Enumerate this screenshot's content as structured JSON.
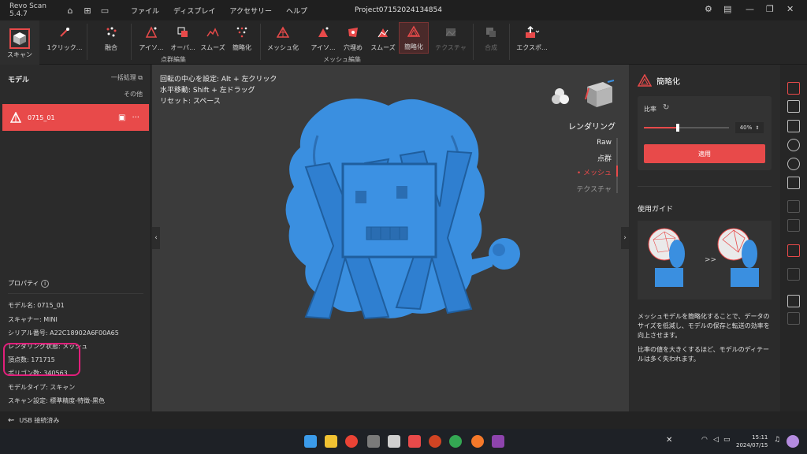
{
  "app": {
    "name": "Revo Scan 5.4.7",
    "project_title": "Project07152024134854"
  },
  "menu": [
    "ファイル",
    "ディスプレイ",
    "アクセサリー",
    "ヘルプ"
  ],
  "toolbar": {
    "scan": "スキャン",
    "one_click": "1クリック...",
    "fuse": "融合",
    "pc_iso": "アイソ...",
    "pc_over": "オーバ...",
    "pc_smooth": "スムーズ",
    "pc_simplify": "簡略化",
    "mesh": "メッシュ化",
    "m_iso": "アイソ...",
    "m_fill": "穴埋め",
    "m_smooth": "スムーズ",
    "m_simplify": "簡略化",
    "texture": "テクスチャ",
    "merge": "合成",
    "export": "エクスポ...",
    "group_pointcloud": "点群編集",
    "group_mesh": "メッシュ編集"
  },
  "left": {
    "header": "モデル",
    "batch": "一括処理",
    "other": "その他",
    "model_name": "0715_01",
    "props_header": "プロパティ",
    "props": [
      "モデル名: 0715_01",
      "スキャナー: MINI",
      "シリアル番号: A22C18902A6F00A65",
      "レンダリング状態: メッシュ",
      "頂点数: 171715",
      "ポリゴン数: 340563",
      "モデルタイプ: スキャン",
      "スキャン設定: 標準精度-特徴-黒色"
    ]
  },
  "viewport": {
    "hints": [
      "回転の中心を設定: Alt + 左クリック",
      "水平移動: Shift + 左ドラッグ",
      "リセット: スペース"
    ],
    "render_title": "レンダリング",
    "render_options": [
      "Raw",
      "点群",
      "メッシュ",
      "テクスチャ"
    ]
  },
  "right": {
    "title": "簡略化",
    "ratio_label": "比率",
    "ratio_value": "40%",
    "ratio_fraction": 0.4,
    "apply": "適用",
    "guide_title": "使用ガイド",
    "guide_arrow": ">>",
    "guide_text1": "メッシュモデルを簡略化することで、データのサイズを低減し、モデルの保存と転送の効率を向上させます。",
    "guide_text2": "比率の値を大きくするほど、モデルのディテールは多く失われます。"
  },
  "status": {
    "usb": "USB 接続済み"
  },
  "taskbar": {
    "time": "15:11",
    "date": "2024/07/15"
  },
  "colors": {
    "accent": "#e84a4a",
    "model": "#3a8fe0",
    "highlight": "#e21f7b"
  }
}
